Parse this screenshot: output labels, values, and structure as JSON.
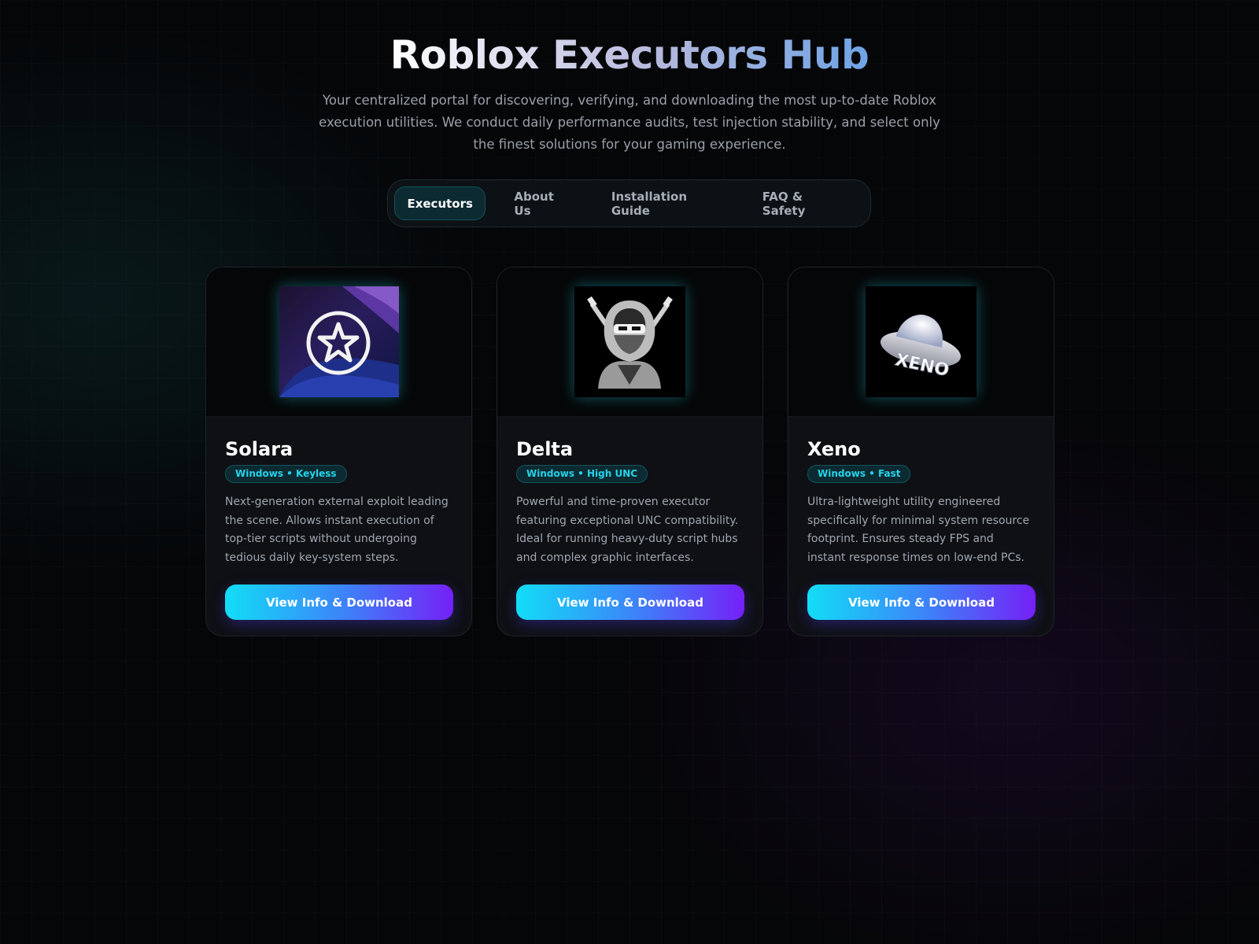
{
  "header": {
    "title": "Roblox Executors Hub",
    "subtitle": "Your centralized portal for discovering, verifying, and downloading the most up-to-date Roblox execution utilities. We conduct daily performance audits, test injection stability, and select only the finest solutions for your gaming experience."
  },
  "nav": {
    "tabs": [
      {
        "label": "Executors",
        "active": true
      },
      {
        "label": "About Us",
        "active": false
      },
      {
        "label": "Installation Guide",
        "active": false
      },
      {
        "label": "FAQ & Safety",
        "active": false
      }
    ]
  },
  "cards": [
    {
      "name": "Solara",
      "badge": "Windows • Keyless",
      "description": "Next-generation external exploit leading the scene. Allows instant execution of top-tier scripts without undergoing tedious daily key-system steps.",
      "button": "View Info & Download",
      "logo_icon": "star-circle-icon"
    },
    {
      "name": "Delta",
      "badge": "Windows • High UNC",
      "description": "Powerful and time-proven executor featuring exceptional UNC compatibility. Ideal for running heavy-duty script hubs and complex graphic interfaces.",
      "button": "View Info & Download",
      "logo_icon": "ninja-icon"
    },
    {
      "name": "Xeno",
      "badge": "Windows • Fast",
      "description": "Ultra-lightweight utility engineered specifically for minimal system resource footprint. Ensures steady FPS and instant response times on low-end PCs.",
      "button": "View Info & Download",
      "logo_icon": "ufo-icon",
      "logo_text": "XENO"
    }
  ],
  "colors": {
    "accent_cyan": "#12ddf7",
    "accent_violet": "#7520f7",
    "badge_text": "#25d3ea",
    "background": "#050608"
  }
}
